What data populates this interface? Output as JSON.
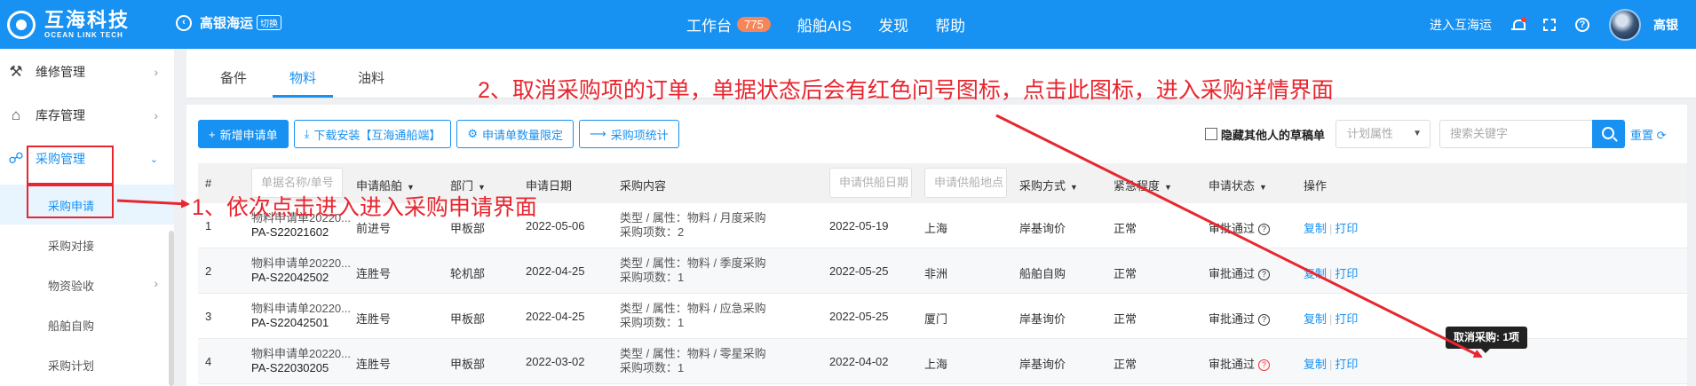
{
  "header": {
    "logo_cn": "互海科技",
    "logo_en": "OCEAN LINK TECH",
    "back_icon": "left-arrow-circle-icon",
    "company": "高银海运",
    "switch_label": "切换",
    "nav": [
      {
        "label": "工作台",
        "badge": "775"
      },
      {
        "label": "船舶AIS"
      },
      {
        "label": "发现"
      },
      {
        "label": "帮助"
      }
    ],
    "enter_link": "进入互海运",
    "user_name": "高银",
    "colors": {
      "brand": "#1791f2",
      "badge": "#f5855b"
    }
  },
  "sidebar": {
    "items": [
      {
        "label": "维修管理",
        "icon": "wrench-icon"
      },
      {
        "label": "库存管理",
        "icon": "home-icon"
      },
      {
        "label": "采购管理",
        "icon": "cart-icon"
      }
    ],
    "sub_items": [
      {
        "label": "采购申请"
      },
      {
        "label": "采购对接"
      },
      {
        "label": "物资验收"
      },
      {
        "label": "船舶自购"
      },
      {
        "label": "采购计划"
      }
    ]
  },
  "tabs": [
    "备件",
    "物料",
    "油料"
  ],
  "toolbar": {
    "new_request": "新增申请单",
    "download": "下载安装【互海通船端】",
    "limit": "申请单数量限定",
    "stats": "采购项统计",
    "hide_drafts": "隐藏其他人的草稿单",
    "plan_attr_placeholder": "计划属性",
    "keyword_placeholder": "搜索关键字",
    "reset": "重置"
  },
  "table": {
    "headers": {
      "no": "#",
      "name_placeholder": "单据名称/单号",
      "ship": "申请船舶",
      "dept": "部门",
      "date": "申请日期",
      "content": "采购内容",
      "supply_date_placeholder": "申请供船日期",
      "supply_place_placeholder": "申请供船地点",
      "method": "采购方式",
      "urgency": "紧急程度",
      "status": "申请状态",
      "ops": "操作"
    },
    "rows": [
      {
        "no": "1",
        "name": "物料申请单20220...",
        "code": "PA-S22021602",
        "ship": "前进号",
        "dept": "甲板部",
        "date": "2022-05-06",
        "type": "类型 / 属性：物料 / 月度采购",
        "items": "采购项数：2",
        "supply_date": "2022-05-19",
        "place": "上海",
        "method": "岸基询价",
        "urgency": "正常",
        "status": "审批通过",
        "copy": "复制",
        "print": "打印"
      },
      {
        "no": "2",
        "name": "物料申请单20220...",
        "code": "PA-S22042502",
        "ship": "连胜号",
        "dept": "轮机部",
        "date": "2022-04-25",
        "type": "类型 / 属性：物料 / 季度采购",
        "items": "采购项数：1",
        "supply_date": "2022-05-25",
        "place": "非洲",
        "method": "船舶自购",
        "urgency": "正常",
        "status": "审批通过",
        "copy": "复制",
        "print": "打印"
      },
      {
        "no": "3",
        "name": "物料申请单20220...",
        "code": "PA-S22042501",
        "ship": "连胜号",
        "dept": "甲板部",
        "date": "2022-04-25",
        "type": "类型 / 属性：物料 / 应急采购",
        "items": "采购项数：1",
        "supply_date": "2022-05-25",
        "place": "厦门",
        "method": "岸基询价",
        "urgency": "正常",
        "status": "审批通过",
        "copy": "复制",
        "print": "打印"
      },
      {
        "no": "4",
        "name": "物料申请单20220...",
        "code": "PA-S22030205",
        "ship": "连胜号",
        "dept": "甲板部",
        "date": "2022-03-02",
        "type": "类型 / 属性：物料 / 零星采购",
        "items": "采购项数：1",
        "supply_date": "2022-04-02",
        "place": "上海",
        "method": "岸基询价",
        "urgency": "正常",
        "status": "审批通过",
        "copy": "复制",
        "print": "打印"
      }
    ]
  },
  "tooltip": "取消采购: 1项",
  "annotations": {
    "step1": "1、依次点击进入进入采购申请界面",
    "step2": "2、取消采购项的订单，单据状态后会有红色问号图标，点击此图标，进入采购详情界面",
    "color": "#e8262f"
  }
}
